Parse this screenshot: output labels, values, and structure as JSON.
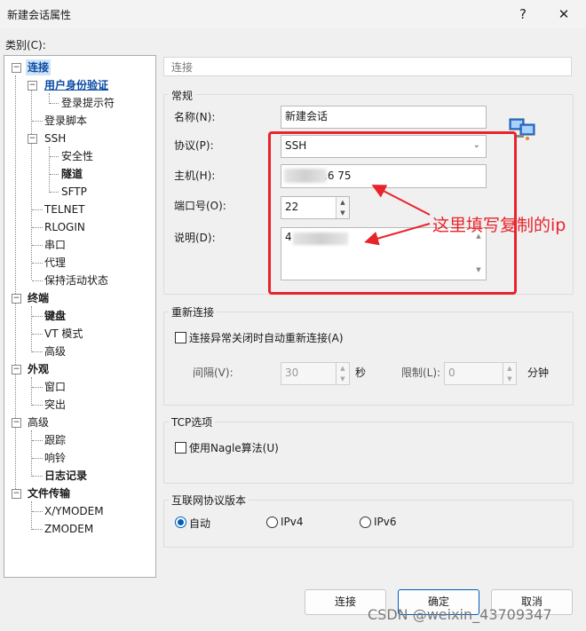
{
  "window": {
    "title": "新建会话属性",
    "help_glyph": "?",
    "close_glyph": "✕"
  },
  "category_label": "类别(C):",
  "tree": {
    "connection": "连接",
    "auth": "用户身份验证",
    "login_prompt": "登录提示符",
    "login_script": "登录脚本",
    "ssh": "SSH",
    "security": "安全性",
    "tunnel": "隧道",
    "sftp": "SFTP",
    "telnet": "TELNET",
    "rlogin": "RLOGIN",
    "serial": "串口",
    "proxy": "代理",
    "keepalive": "保持活动状态",
    "terminal": "终端",
    "keyboard": "键盘",
    "vt_mode": "VT 模式",
    "advanced_term": "高级",
    "appearance": "外观",
    "window": "窗口",
    "highlight": "突出",
    "advanced": "高级",
    "trace": "跟踪",
    "bell": "响铃",
    "logging": "日志记录",
    "file_transfer": "文件传输",
    "xymodem": "X/YMODEM",
    "zmodem": "ZMODEM"
  },
  "panel": {
    "header": "连接",
    "general": {
      "title": "常规",
      "name_label": "名称(N):",
      "name_value": "新建会话",
      "protocol_label": "协议(P):",
      "protocol_value": "SSH",
      "host_label": "主机(H):",
      "host_value": ".6 75",
      "port_label": "端口号(O):",
      "port_value": "22",
      "desc_label": "说明(D):",
      "desc_value": "4"
    },
    "reconnect": {
      "title": "重新连接",
      "auto_label": "连接异常关闭时自动重新连接(A)",
      "interval_label": "间隔(V):",
      "interval_value": "30",
      "interval_unit": "秒",
      "limit_label": "限制(L):",
      "limit_value": "0",
      "limit_unit": "分钟"
    },
    "tcp": {
      "title": "TCP选项",
      "nagle_label": "使用Nagle算法(U)"
    },
    "ipver": {
      "title": "互联网协议版本",
      "auto": "自动",
      "ipv4": "IPv4",
      "ipv6": "IPv6"
    }
  },
  "buttons": {
    "connect": "连接",
    "ok": "确定",
    "cancel": "取消"
  },
  "annotation": "这里填写复制的ip",
  "watermark": "CSDN @weixin_43709347",
  "colors": {
    "accent": "#005fb8",
    "annotation_red": "#e8242b",
    "tree_selected": "#cde4f7"
  }
}
